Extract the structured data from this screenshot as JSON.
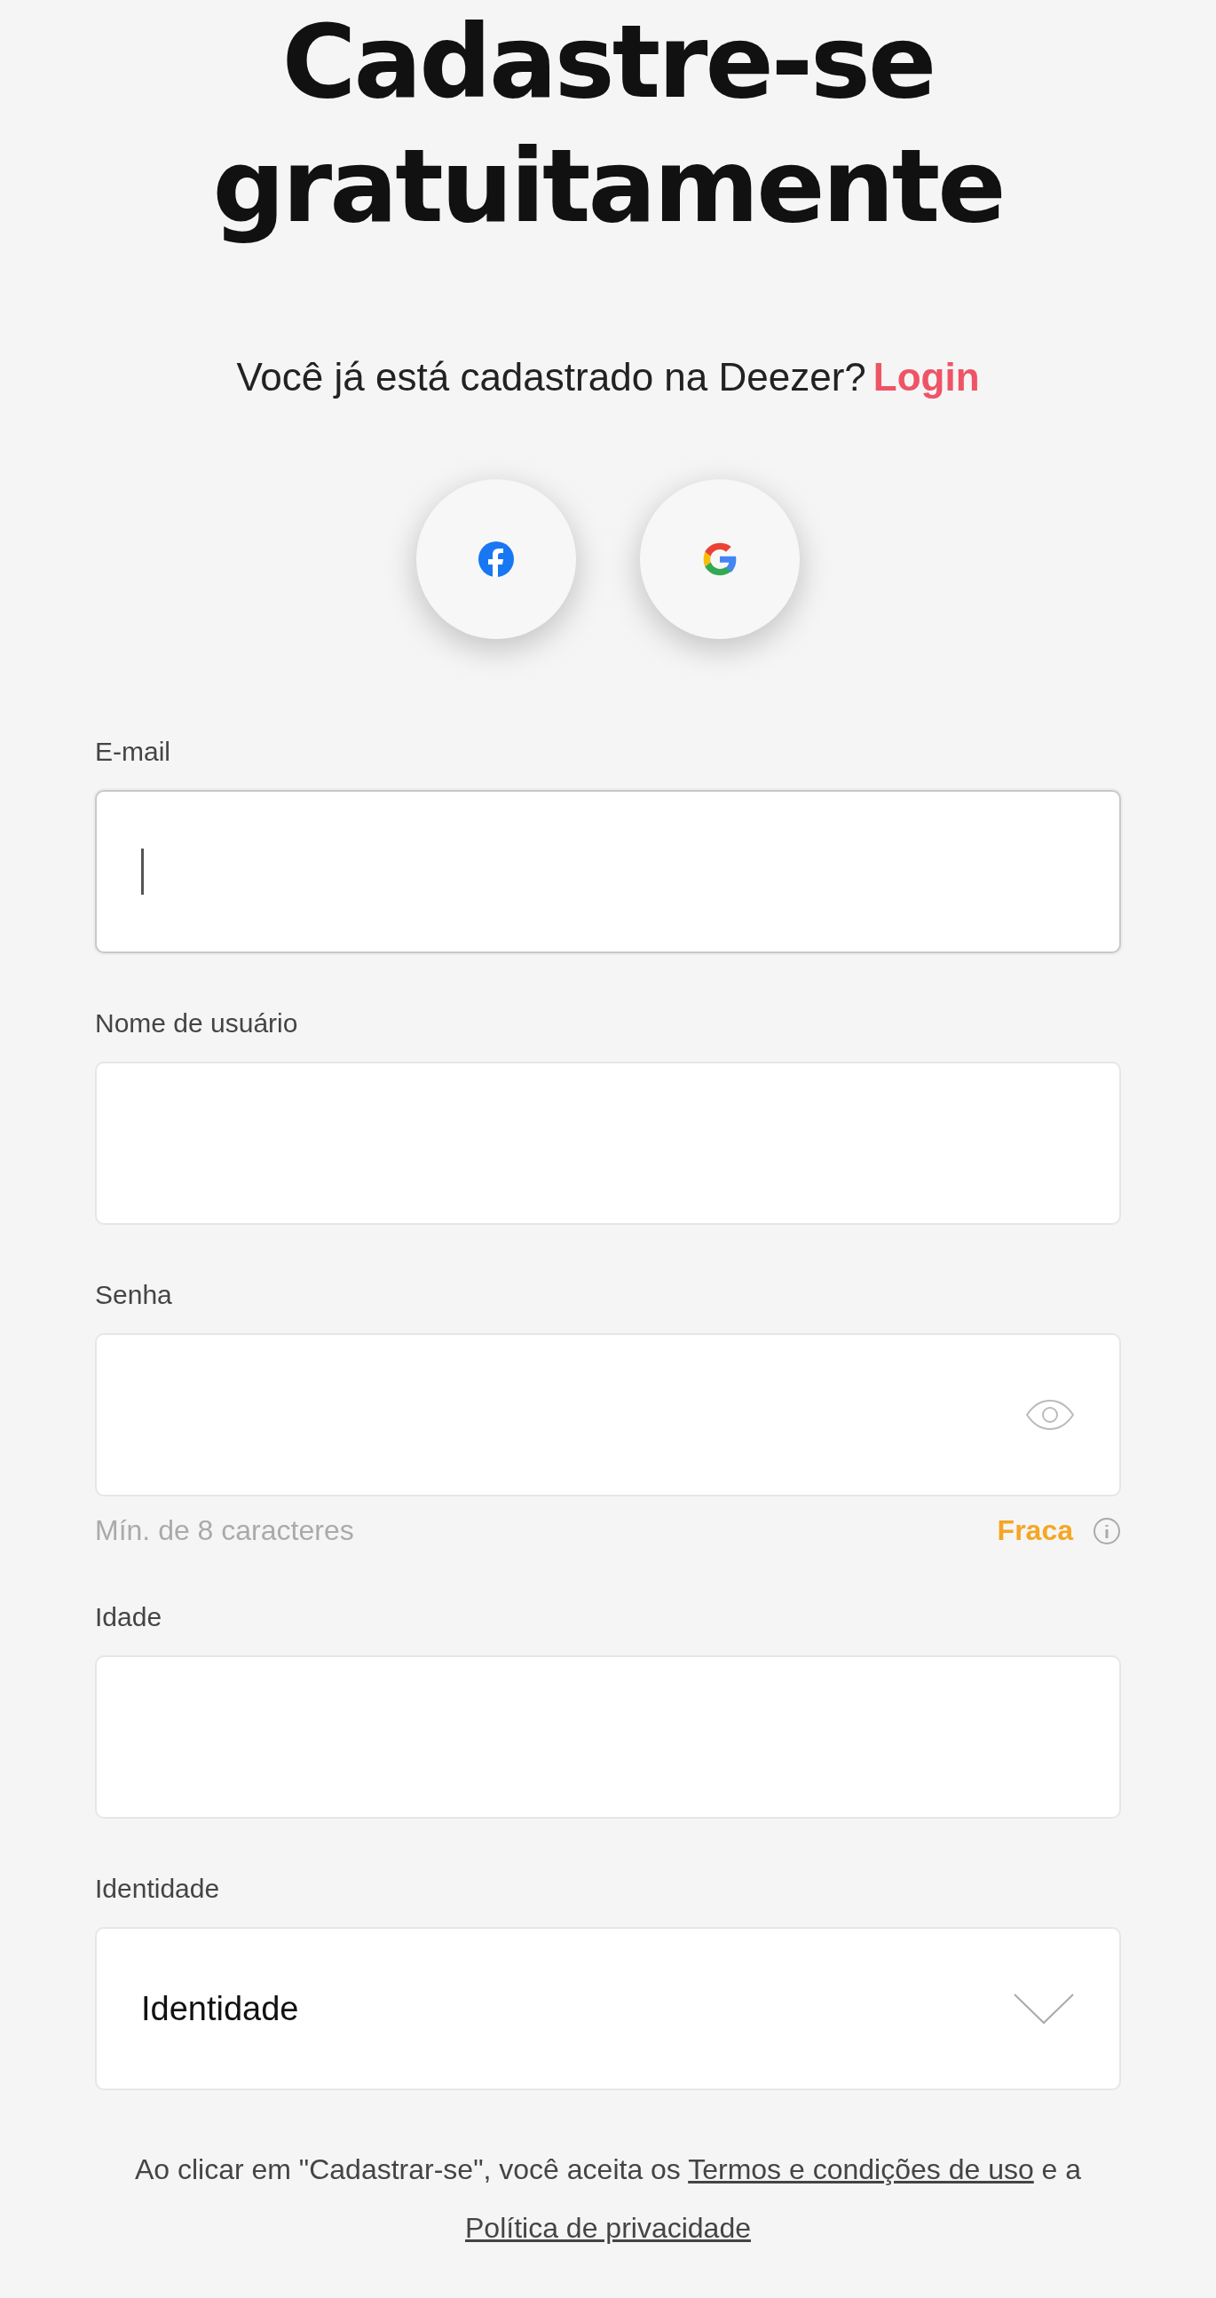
{
  "title": [
    "Cadastre-se",
    "gratuitamente"
  ],
  "subtitle": {
    "text": "Você já está cadastrado na Deezer?",
    "link": "Login"
  },
  "social": [
    {
      "kind": "facebook"
    },
    {
      "kind": "google"
    }
  ],
  "fields": [
    {
      "kind": "text",
      "label": "E-mail",
      "focused": true
    },
    {
      "kind": "text",
      "label": "Nome de usuário",
      "focused": false
    },
    {
      "kind": "password",
      "label": "Senha",
      "focused": false,
      "hint": "Mín. de 8 caracteres",
      "strength": "Fraca"
    },
    {
      "kind": "text",
      "label": "Idade",
      "focused": false
    },
    {
      "kind": "select",
      "label": "Identidade",
      "value": "Identidade"
    }
  ],
  "terms": [
    {
      "kind": "text",
      "text": "Ao clicar em \"Cadastrar-se\", você aceita os"
    },
    {
      "kind": "link",
      "text": "Termos e condições de uso"
    },
    {
      "kind": "text",
      "text": "e a"
    },
    {
      "kind": "link",
      "text": "Política de privacidade"
    }
  ]
}
